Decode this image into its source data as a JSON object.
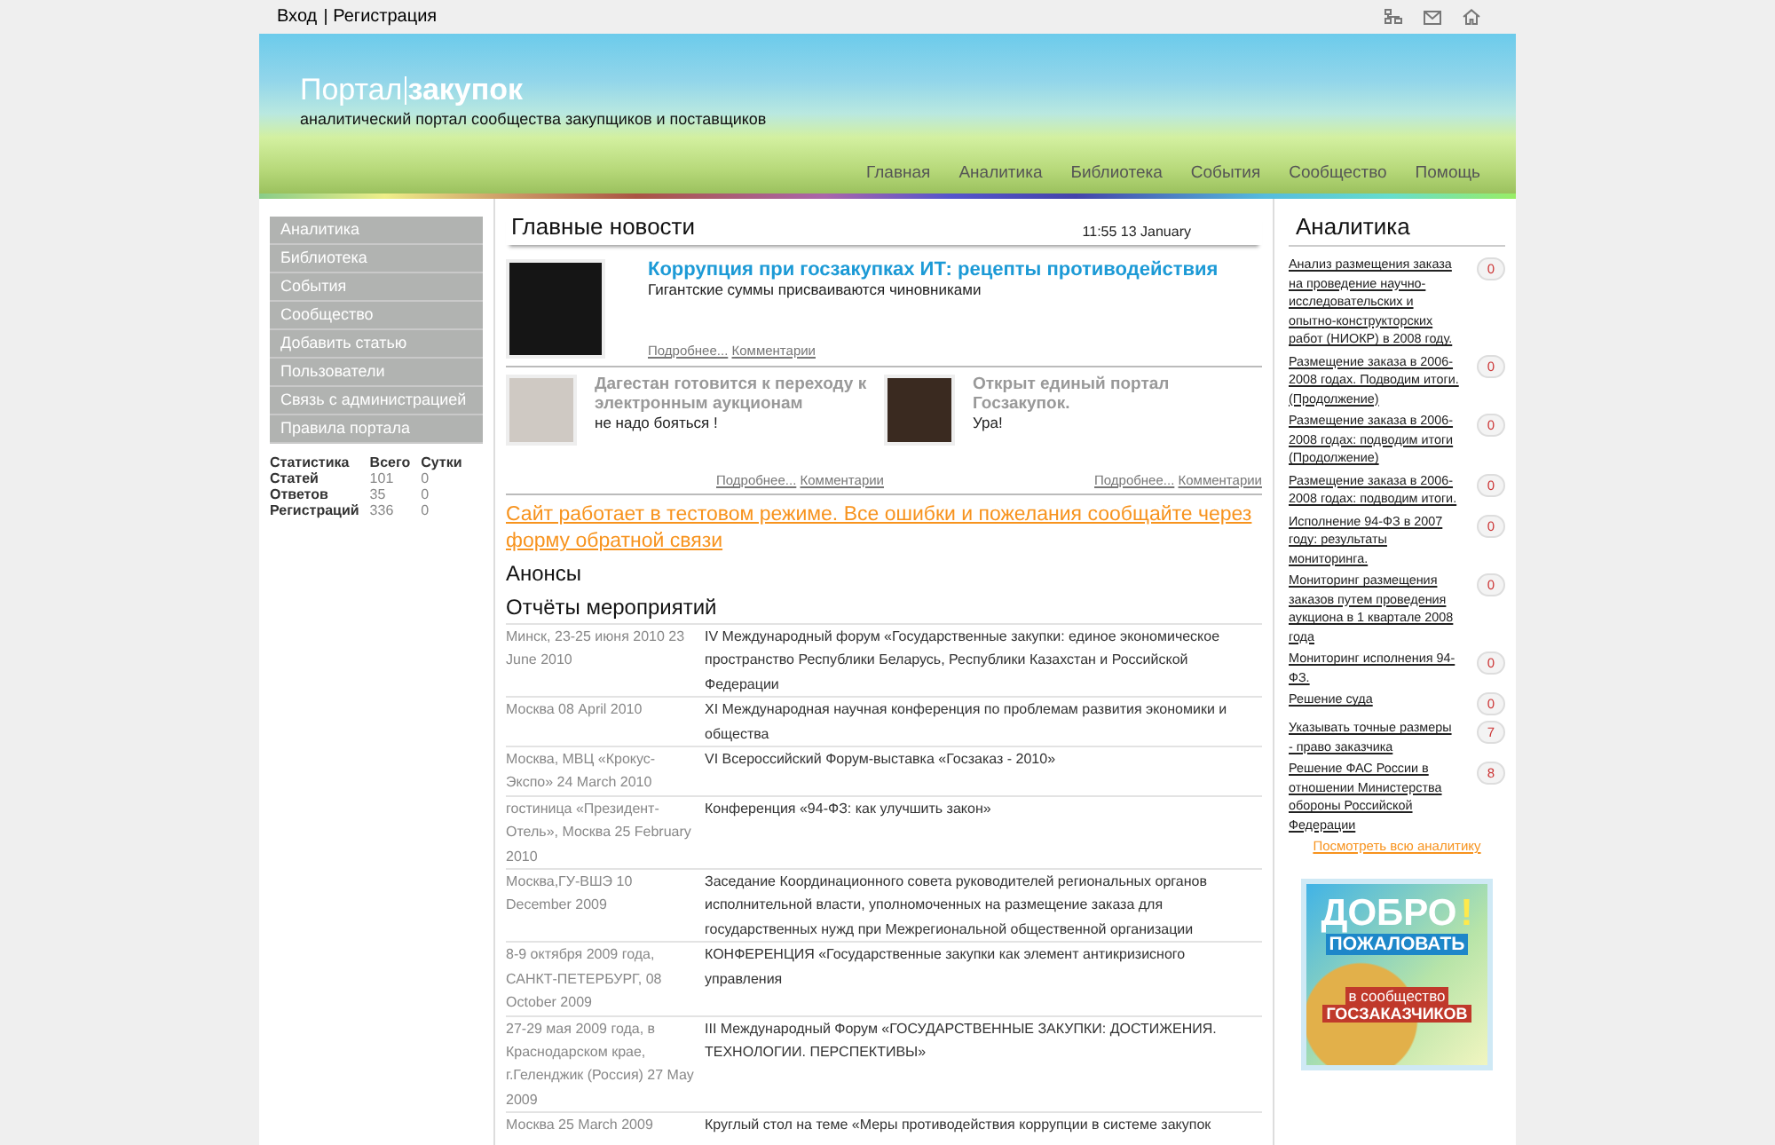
{
  "top_links": [
    "Вход",
    "Регистрация"
  ],
  "logo": {
    "light": "Портал",
    "bold": "закупок"
  },
  "tagline": "аналитический портал сообщества закупщиков и поставщиков",
  "nav": [
    "Главная",
    "Аналитика",
    "Библиотека",
    "События",
    "Сообщество",
    "Помощь"
  ],
  "sidebar": {
    "items": [
      "Аналитика",
      "Библиотека",
      "События",
      "Сообщество",
      "Добавить статью",
      "Пользователи",
      "Связь с администрацией",
      "Правила портала"
    ],
    "stats": {
      "columns": [
        "Статистика",
        "Всего",
        "Сутки"
      ],
      "rows": [
        [
          "Статей",
          "101",
          "0"
        ],
        [
          "Ответов",
          "35",
          "0"
        ],
        [
          "Регистраций",
          "336",
          "0"
        ]
      ]
    }
  },
  "news": {
    "title": "Главные новости",
    "time": "11:55 13 January",
    "main": {
      "title": "Коррупция при госзакупках ИТ: рецепты противодействия",
      "summary": "Гигантские суммы присваиваются чиновниками",
      "more": "Подробнее...",
      "comments": "Комментарии"
    },
    "secondary": [
      {
        "title": "Дагестан готовится к переходу к электронным аукционам",
        "summary": "не надо бояться !",
        "more": "Подробнее...",
        "comments": "Комментарии"
      },
      {
        "title": "Открыт единый портал Госзакупок.",
        "summary": "Ура!",
        "more": "Подробнее...",
        "comments": "Комментарии"
      }
    ]
  },
  "notice": "Сайт работает в тестовом режиме. Все ошибки и пожелания сообщайте через форму обратной связи",
  "announcements_title": "Анонсы",
  "events_title": "Отчёты мероприятий",
  "events": [
    {
      "date": "Минск, 23-25 июня 2010 23 June 2010",
      "title": "IV Международный форум «Государственные закупки: единое экономическое пространство Республики Беларусь, Республики Казахстан и Российской Федерации"
    },
    {
      "date": "Москва 08 April 2010",
      "title": "XI Международная научная конференция по проблемам развития экономики и общества"
    },
    {
      "date": "Москва, МВЦ «Крокус-Экспо» 24 March 2010",
      "title": "VI Всероссийский Форум-выставка «Госзаказ - 2010»"
    },
    {
      "date": "гостиница «Президент-Отель», Москва 25 February 2010",
      "title": "Конференция «94-ФЗ: как улучшить закон»"
    },
    {
      "date": "Москва,ГУ-ВШЭ 10 December 2009",
      "title": "Заседание Координационного совета руководителей региональных органов исполнительной власти, уполномоченных на размещение заказа для государственных нужд при Межрегиональной общественной организации"
    },
    {
      "date": "8-9 октября 2009 года, САНКТ-ПЕТЕРБУРГ, 08 October 2009",
      "title": "КОНФЕРЕНЦИЯ «Государственные закупки как элемент антикризисного управления"
    },
    {
      "date": "27-29 мая 2009 года, в Краснодарском крае, г.Геленджик (Россия) 27 May 2009",
      "title": "III Международный Форум «ГОСУДАРСТВЕННЫЕ ЗАКУПКИ: ДОСТИЖЕНИЯ. ТЕХНОЛОГИИ. ПЕРСПЕКТИВЫ»"
    },
    {
      "date": "Москва 25 March 2009",
      "title": "Круглый стол на теме «Меры противодействия коррупции в системе закупок"
    }
  ],
  "analytics": {
    "title": "Аналитика",
    "items": [
      {
        "title": "Анализ размещения заказа на проведение научно-исследовательских и опытно-конструкторских работ (НИОКР) в 2008 году.",
        "count": "0"
      },
      {
        "title": "Размещение заказа в 2006-2008 годах. Подводим итоги. (Продолжение)",
        "count": "0"
      },
      {
        "title": "Размещение заказа в 2006-2008 годах: подводим итоги (Продолжение)",
        "count": "0"
      },
      {
        "title": "Размещение заказа в 2006-2008 годах: подводим итоги.",
        "count": "0"
      },
      {
        "title": "Исполнение 94-ФЗ в 2007 году: результаты мониторинга.",
        "count": "0"
      },
      {
        "title": "Мониторинг размещения заказов путем проведения аукциона в 1 квартале 2008 года",
        "count": "0"
      },
      {
        "title": "Мониторинг исполнения 94-ФЗ.",
        "count": "0"
      },
      {
        "title": "Решение суда",
        "count": "0"
      },
      {
        "title": "Указывать точные размеры - право заказчика",
        "count": "7"
      },
      {
        "title": "Решение ФАС России в отношении Министерства обороны Российской Федерации",
        "count": "8"
      }
    ],
    "all_link": "Посмотреть всю аналитику"
  },
  "banner": {
    "line1": "ДОБРО",
    "line2": "ПОЖАЛОВАТЬ",
    "mark": "!",
    "line3": "в сообщество",
    "line4": "ГОСЗАКАЗЧИКОВ"
  }
}
